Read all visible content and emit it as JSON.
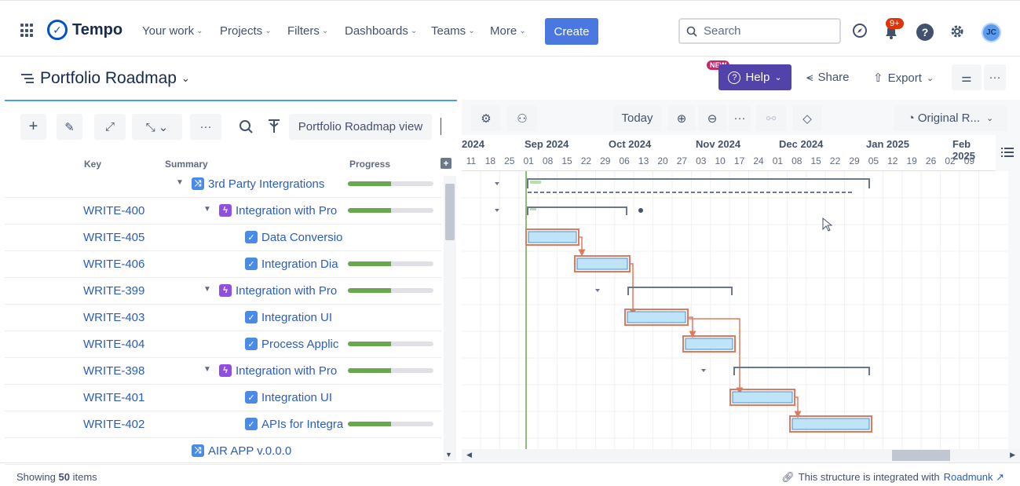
{
  "app": {
    "name": "Tempo"
  },
  "nav": [
    {
      "label": "Your work"
    },
    {
      "label": "Projects"
    },
    {
      "label": "Filters"
    },
    {
      "label": "Dashboards"
    },
    {
      "label": "Teams"
    },
    {
      "label": "More"
    }
  ],
  "create_label": "Create",
  "search": {
    "placeholder": "Search"
  },
  "notifications": {
    "count": "9+"
  },
  "user": {
    "initials": "JC"
  },
  "page": {
    "title": "Portfolio Roadmap"
  },
  "actions": {
    "new_tag": "NEW",
    "help": "Help",
    "share": "Share",
    "export": "Export"
  },
  "toolbar": {
    "view_name": "Portfolio Roadmap view",
    "today": "Today",
    "original": "Original R..."
  },
  "columns": {
    "key": "Key",
    "summary": "Summary",
    "progress": "Progress"
  },
  "rows": [
    {
      "key": "",
      "summary": "3rd Party Intergrations",
      "type": "release",
      "level": 0,
      "expanded": true,
      "progress": 0.5
    },
    {
      "key": "WRITE-400",
      "summary": "Integration with Pro",
      "type": "epic",
      "level": 1,
      "expanded": true,
      "progress": 0.5
    },
    {
      "key": "WRITE-405",
      "summary": "Data Conversio",
      "type": "task",
      "level": 2,
      "progress": null
    },
    {
      "key": "WRITE-406",
      "summary": "Integration Dia",
      "type": "task",
      "level": 2,
      "progress": 0.5
    },
    {
      "key": "WRITE-399",
      "summary": "Integration with Pro",
      "type": "epic",
      "level": 1,
      "expanded": true,
      "progress": 0.5
    },
    {
      "key": "WRITE-403",
      "summary": "Integration UI",
      "type": "task",
      "level": 2,
      "progress": null
    },
    {
      "key": "WRITE-404",
      "summary": "Process Applic",
      "type": "task",
      "level": 2,
      "progress": 0.5
    },
    {
      "key": "WRITE-398",
      "summary": "Integration with Pro",
      "type": "epic",
      "level": 1,
      "expanded": true,
      "progress": 0.5
    },
    {
      "key": "WRITE-401",
      "summary": "Integration UI",
      "type": "task",
      "level": 2,
      "progress": null
    },
    {
      "key": "WRITE-402",
      "summary": "APIs for Integra",
      "type": "task",
      "level": 2,
      "progress": 0.5
    },
    {
      "key": "",
      "summary": "AIR APP v.0.0.0",
      "type": "release",
      "level": 0,
      "progress": null
    }
  ],
  "timeline": {
    "months": [
      "2024",
      "Sep 2024",
      "Oct 2024",
      "Nov 2024",
      "Dec 2024",
      "Jan 2025",
      "Feb 2025"
    ],
    "weeks": [
      "11",
      "18",
      "25",
      "01",
      "08",
      "15",
      "22",
      "29",
      "06",
      "13",
      "20",
      "27",
      "03",
      "10",
      "17",
      "24",
      "01",
      "08",
      "15",
      "22",
      "29",
      "05",
      "12",
      "19",
      "26",
      "02",
      "09"
    ]
  },
  "footer": {
    "showing_prefix": "Showing",
    "showing_count": "50",
    "showing_suffix": "items",
    "integration_text": "This structure is integrated with",
    "integration_link": "Roadmunk ↗"
  },
  "colors": {
    "create": "#4a77e0",
    "help": "#5243aa",
    "progress": "#6aa84f",
    "bar_fill": "#bfe3f7",
    "bar_border": "#e07a5f",
    "epic": "#904ee2",
    "task": "#4b8be6",
    "release": "#4b8be6"
  }
}
